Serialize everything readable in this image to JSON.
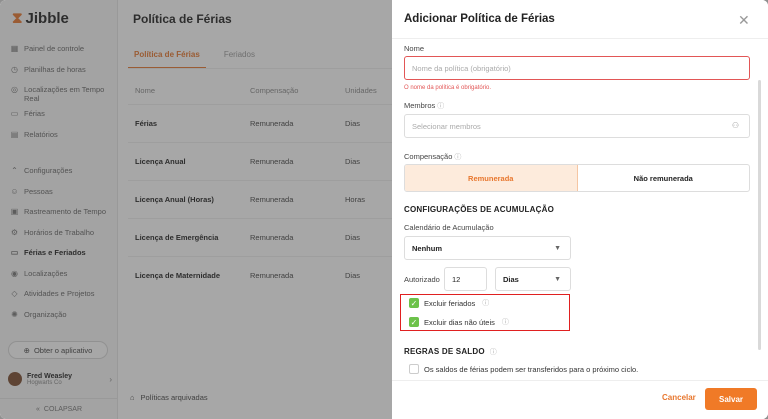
{
  "brand": {
    "name": "Jibble"
  },
  "sidebar": {
    "items": [
      {
        "label": "Painel de controle",
        "icon": "dashboard-icon"
      },
      {
        "label": "Planilhas de horas",
        "icon": "clock-icon"
      },
      {
        "label": "Localizações em Tempo Real",
        "icon": "location-icon"
      },
      {
        "label": "Férias",
        "icon": "calendar-icon"
      },
      {
        "label": "Relatórios",
        "icon": "report-icon"
      }
    ],
    "section2": [
      {
        "label": "Configurações",
        "icon": "chevron-up-icon"
      },
      {
        "label": "Pessoas",
        "icon": "people-icon"
      },
      {
        "label": "Rastreamento de Tempo",
        "icon": "time-tracking-icon"
      },
      {
        "label": "Horários de Trabalho",
        "icon": "work-schedule-icon"
      },
      {
        "label": "Férias e Feriados",
        "icon": "holiday-icon",
        "active": true
      },
      {
        "label": "Localizações",
        "icon": "pin-icon"
      },
      {
        "label": "Atividades e Projetos",
        "icon": "tag-icon"
      },
      {
        "label": "Organização",
        "icon": "gear-icon"
      }
    ],
    "get_app": "Obter o aplicativo",
    "user": {
      "name": "Fred Weasley",
      "org": "Hogwarts Co"
    },
    "collapse": "COLAPSAR"
  },
  "main": {
    "title": "Política de Férias",
    "tabs": [
      "Política de Férias",
      "Feriados"
    ],
    "columns": [
      "Nome",
      "Compensação",
      "Unidades"
    ],
    "rows": [
      [
        "Férias",
        "Remunerada",
        "Dias"
      ],
      [
        "Licença Anual",
        "Remunerada",
        "Dias"
      ],
      [
        "Licença Anual (Horas)",
        "Remunerada",
        "Horas"
      ],
      [
        "Licença de Emergência",
        "Remunerada",
        "Dias"
      ],
      [
        "Licença de Maternidade",
        "Remunerada",
        "Dias"
      ]
    ],
    "archived": "Políticas arquivadas"
  },
  "panel": {
    "title": "Adicionar Política de Férias",
    "name_label": "Nome",
    "name_placeholder": "Nome da política (obrigatório)",
    "name_error": "O nome da política é obrigatório.",
    "members_label": "Membros",
    "members_placeholder": "Selecionar membros",
    "compensation_label": "Compensação",
    "compensation_options": [
      "Remunerada",
      "Não remunerada"
    ],
    "accrual_heading": "CONFIGURAÇÕES DE ACUMULAÇÃO",
    "calendar_label": "Calendário de Acumulação",
    "calendar_value": "Nenhum",
    "authorized_label": "Autorizado",
    "authorized_value": "12",
    "unit_value": "Dias",
    "exclude_holidays": "Excluir feriados",
    "exclude_nonworking": "Excluir dias não úteis",
    "balance_heading": "REGRAS DE SALDO",
    "carryover": "Os saldos de férias podem ser transferidos para o próximo ciclo.",
    "cancel": "Cancelar",
    "save": "Salvar"
  },
  "colors": {
    "accent": "#f07a27",
    "error": "#e25656",
    "check": "#6cc24a"
  }
}
